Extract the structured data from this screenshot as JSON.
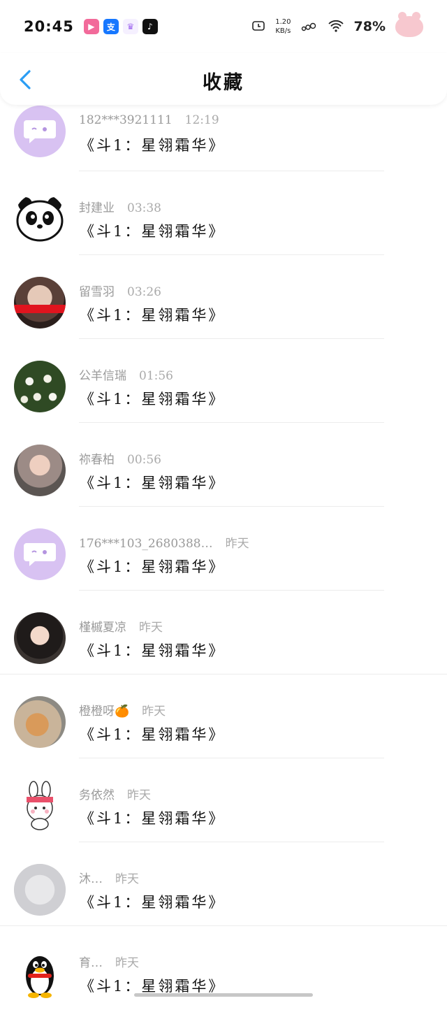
{
  "status_bar": {
    "time": "20:45",
    "net_speed_value": "1.20",
    "net_speed_unit": "KB/s",
    "battery": "78%",
    "app_icons": [
      {
        "name": "bilibili-icon",
        "color": "#f26a9a"
      },
      {
        "name": "alipay-icon",
        "color": "#1677ff",
        "glyph": "支"
      },
      {
        "name": "crown-app-icon",
        "color": "#f5f0ff"
      },
      {
        "name": "tiktok-icon",
        "color": "#111111"
      }
    ]
  },
  "nav": {
    "title": "收藏"
  },
  "colors": {
    "accent": "#2a9df4",
    "meta_text": "#9a9a9a",
    "title_text": "#111111"
  },
  "favorites": [
    {
      "name": "182***3921111",
      "time": "12:19",
      "title": "《斗1：星翎霜华》",
      "avatar": "chat-bubble"
    },
    {
      "name": "封建业",
      "time": "03:38",
      "title": "《斗1：星翎霜华》",
      "avatar": "panda"
    },
    {
      "name": "留雪羽",
      "time": "03:26",
      "title": "《斗1：星翎霜华》",
      "avatar": "photo"
    },
    {
      "name": "公羊信瑞",
      "time": "01:56",
      "title": "《斗1：星翎霜华》",
      "avatar": "flowers"
    },
    {
      "name": "祢春柏",
      "time": "00:56",
      "title": "《斗1：星翎霜华》",
      "avatar": "photo"
    },
    {
      "name": "176***103_2680388…",
      "time": "昨天",
      "title": "《斗1：星翎霜华》",
      "avatar": "chat-bubble"
    },
    {
      "name": "槿槭夏凉",
      "time": "昨天",
      "title": "《斗1：星翎霜华》",
      "avatar": "photo"
    },
    {
      "name": "橙橙呀🍊",
      "time": "昨天",
      "title": "《斗1：星翎霜华》",
      "avatar": "cat"
    },
    {
      "name": "务依然",
      "time": "昨天",
      "title": "《斗1：星翎霜华》",
      "avatar": "bunny"
    },
    {
      "name": "沐…",
      "time": "昨天",
      "title": "《斗1：星翎霜华》",
      "avatar": "blur"
    },
    {
      "name": "育…",
      "time": "昨天",
      "title": "《斗1：星翎霜华》",
      "avatar": "penguin"
    }
  ]
}
